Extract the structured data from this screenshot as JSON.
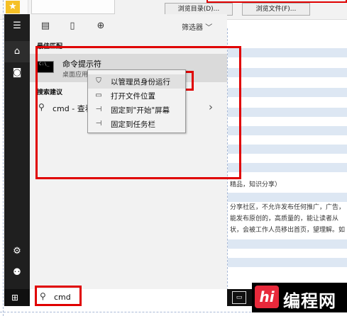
{
  "background_window": {
    "button_browse_dir": "浏览目录(D)...",
    "button_browse_file": "浏览文件(F)...",
    "text_line_1": "精品，知识分享）",
    "text_line_2": "分享社区，不允许发布任何推广，广告，",
    "text_line_3": "能发布原创的，高质量的，能让读者从",
    "text_line_4": "状，会被工作人员移出首页，望理解。如"
  },
  "start_menu": {
    "filter_label": "筛选器",
    "best_match_label": "最佳匹配",
    "best_match": {
      "title": "命令提示符",
      "subtitle": "桌面应用",
      "icon_text": "C:\\_"
    },
    "suggestions_label": "搜索建议",
    "suggestion": {
      "text": "cmd - 查看网页结果"
    },
    "search": {
      "value": "cmd"
    }
  },
  "context_menu": {
    "items": [
      {
        "label": "以管理员身份运行",
        "icon": "shield-icon"
      },
      {
        "label": "打开文件位置",
        "icon": "folder-icon"
      },
      {
        "label": "固定到\"开始\"屏幕",
        "icon": "pin-icon"
      },
      {
        "label": "固定到任务栏",
        "icon": "pin-icon"
      }
    ]
  },
  "watermark": {
    "text": "编程网",
    "logo_text": "hi"
  },
  "colors": {
    "highlight_red": "#e00000",
    "rail_dark": "#1f1f1f",
    "panel_gray": "#f2f2f2"
  }
}
